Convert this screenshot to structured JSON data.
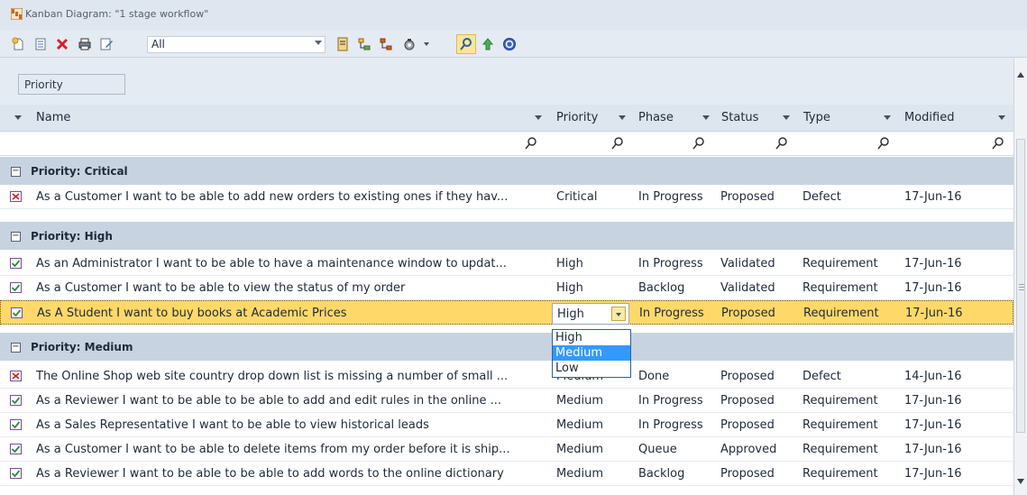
{
  "window": {
    "title": "Kanban Diagram: \"1 stage workflow\""
  },
  "toolbar": {
    "filter_value": "All",
    "icons": [
      "new-element-icon",
      "properties-icon",
      "delete-icon",
      "print-icon",
      "edit-icon",
      "hierarchy-icon",
      "parent-child-icon",
      "tree-icon",
      "options-icon",
      "find-icon",
      "move-up-icon",
      "help-icon"
    ]
  },
  "group_by": {
    "chip_label": "Priority"
  },
  "columns": [
    "Name",
    "Priority",
    "Phase",
    "Status",
    "Type",
    "Modified"
  ],
  "groups": [
    {
      "label": "Priority: Critical",
      "rows": [
        {
          "icon": "defect-icon",
          "name": "As a Customer I want to be able to add new orders to existing ones if they hav...",
          "priority": "Critical",
          "phase": "In Progress",
          "status": "Proposed",
          "type": "Defect",
          "modified": "17-Jun-16"
        }
      ]
    },
    {
      "label": "Priority: High",
      "rows": [
        {
          "icon": "requirement-icon",
          "name": "As an Administrator I want to be able to have a maintenance window to updat...",
          "priority": "High",
          "phase": "In Progress",
          "status": "Validated",
          "type": "Requirement",
          "modified": "17-Jun-16"
        },
        {
          "icon": "requirement-icon",
          "name": "As a Customer I want to be able to view the status of my order",
          "priority": "High",
          "phase": "Backlog",
          "status": "Validated",
          "type": "Requirement",
          "modified": "17-Jun-16"
        },
        {
          "icon": "requirement-icon",
          "name": "As A Student I want to buy books at Academic Prices",
          "priority": "High",
          "phase": "In Progress",
          "status": "Proposed",
          "type": "Requirement",
          "modified": "17-Jun-16",
          "selected": true
        }
      ]
    },
    {
      "label": "Priority: Medium",
      "rows": [
        {
          "icon": "defect-icon",
          "name": "The Online Shop web site country drop down list is missing a number of small ...",
          "priority": "Medium",
          "phase": "Done",
          "status": "Proposed",
          "type": "Defect",
          "modified": "14-Jun-16"
        },
        {
          "icon": "requirement-icon",
          "name": "As a Reviewer I want to be able to be able to add and edit rules in the online ...",
          "priority": "Medium",
          "phase": "In Progress",
          "status": "Proposed",
          "type": "Requirement",
          "modified": "17-Jun-16"
        },
        {
          "icon": "requirement-icon",
          "name": "As a Sales Representative I want to be able to view historical leads",
          "priority": "Medium",
          "phase": "In Progress",
          "status": "Proposed",
          "type": "Requirement",
          "modified": "17-Jun-16"
        },
        {
          "icon": "requirement-icon",
          "name": "As a Customer I want to be able to delete items from my order before it is ship...",
          "priority": "Medium",
          "phase": "Queue",
          "status": "Approved",
          "type": "Requirement",
          "modified": "17-Jun-16"
        },
        {
          "icon": "requirement-icon",
          "name": "As a Reviewer I want to be able to be able to add words to the online dictionary",
          "priority": "Medium",
          "phase": "Backlog",
          "status": "Proposed",
          "type": "Requirement",
          "modified": "17-Jun-16"
        }
      ]
    }
  ],
  "priority_editor": {
    "value": "High",
    "options": [
      "High",
      "Medium",
      "Low"
    ],
    "highlighted": "Medium"
  },
  "colors": {
    "selected_row": "#fed96a",
    "group_row": "#c7d3e0",
    "dropdown_highlight": "#3399ff"
  }
}
